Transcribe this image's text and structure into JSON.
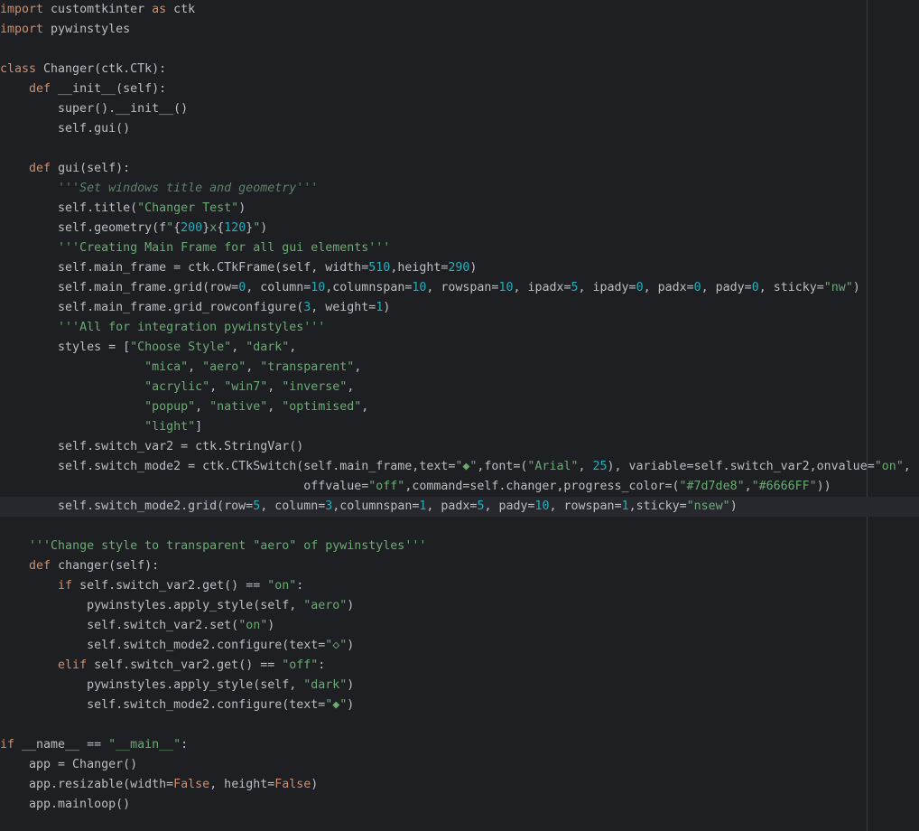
{
  "editor": {
    "colors": {
      "background": "#1e1f22",
      "text": "#bcbec4",
      "keyword": "#cf8e6d",
      "string": "#6aab73",
      "docstring": "#5f826b",
      "number": "#2aacb8",
      "current_line": "#26282e"
    },
    "current_line_index": 25,
    "lines": [
      [
        [
          "kw",
          "import"
        ],
        [
          "plain",
          " customtkinter "
        ],
        [
          "kw",
          "as"
        ],
        [
          "plain",
          " ctk"
        ]
      ],
      [
        [
          "kw",
          "import"
        ],
        [
          "plain",
          " pywinstyles"
        ]
      ],
      [],
      [
        [
          "kw",
          "class"
        ],
        [
          "plain",
          " Changer(ctk.CTk):"
        ]
      ],
      [
        [
          "plain",
          "    "
        ],
        [
          "kw",
          "def"
        ],
        [
          "plain",
          " __init__(self):"
        ]
      ],
      [
        [
          "plain",
          "        super().__init__()"
        ]
      ],
      [
        [
          "plain",
          "        self.gui()"
        ]
      ],
      [],
      [
        [
          "plain",
          "    "
        ],
        [
          "kw",
          "def"
        ],
        [
          "plain",
          " gui(self):"
        ]
      ],
      [
        [
          "plain",
          "        "
        ],
        [
          "doc",
          "'''Set windows title and geometry'''"
        ]
      ],
      [
        [
          "plain",
          "        self.title("
        ],
        [
          "str",
          "\"Changer Test\""
        ],
        [
          "plain",
          ")"
        ]
      ],
      [
        [
          "plain",
          "        self.geometry(f"
        ],
        [
          "str",
          "\""
        ],
        [
          "plain",
          "{"
        ],
        [
          "num",
          "200"
        ],
        [
          "plain",
          "}"
        ],
        [
          "str",
          "x"
        ],
        [
          "plain",
          "{"
        ],
        [
          "num",
          "120"
        ],
        [
          "plain",
          "}"
        ],
        [
          "str",
          "\""
        ],
        [
          "plain",
          ")"
        ]
      ],
      [
        [
          "plain",
          "        "
        ],
        [
          "str",
          "'''Creating Main Frame for all gui elements'''"
        ]
      ],
      [
        [
          "plain",
          "        self.main_frame = ctk.CTkFrame(self, width="
        ],
        [
          "num",
          "510"
        ],
        [
          "plain",
          ",height="
        ],
        [
          "num",
          "290"
        ],
        [
          "plain",
          ")"
        ]
      ],
      [
        [
          "plain",
          "        self.main_frame.grid(row="
        ],
        [
          "num",
          "0"
        ],
        [
          "plain",
          ", column="
        ],
        [
          "num",
          "10"
        ],
        [
          "plain",
          ",columnspan="
        ],
        [
          "num",
          "10"
        ],
        [
          "plain",
          ", rowspan="
        ],
        [
          "num",
          "10"
        ],
        [
          "plain",
          ", ipadx="
        ],
        [
          "num",
          "5"
        ],
        [
          "plain",
          ", ipady="
        ],
        [
          "num",
          "0"
        ],
        [
          "plain",
          ", padx="
        ],
        [
          "num",
          "0"
        ],
        [
          "plain",
          ", pady="
        ],
        [
          "num",
          "0"
        ],
        [
          "plain",
          ", sticky="
        ],
        [
          "str",
          "\"nw\""
        ],
        [
          "plain",
          ")"
        ]
      ],
      [
        [
          "plain",
          "        self.main_frame.grid_rowconfigure("
        ],
        [
          "num",
          "3"
        ],
        [
          "plain",
          ", weight="
        ],
        [
          "num",
          "1"
        ],
        [
          "plain",
          ")"
        ]
      ],
      [
        [
          "plain",
          "        "
        ],
        [
          "str",
          "'''All for integration pywinstyles'''"
        ]
      ],
      [
        [
          "plain",
          "        styles = ["
        ],
        [
          "str",
          "\"Choose Style\""
        ],
        [
          "plain",
          ", "
        ],
        [
          "str",
          "\"dark\""
        ],
        [
          "plain",
          ","
        ]
      ],
      [
        [
          "plain",
          "                    "
        ],
        [
          "str",
          "\"mica\""
        ],
        [
          "plain",
          ", "
        ],
        [
          "str",
          "\"aero\""
        ],
        [
          "plain",
          ", "
        ],
        [
          "str",
          "\"transparent\""
        ],
        [
          "plain",
          ","
        ]
      ],
      [
        [
          "plain",
          "                    "
        ],
        [
          "str",
          "\"acrylic\""
        ],
        [
          "plain",
          ", "
        ],
        [
          "str",
          "\"win7\""
        ],
        [
          "plain",
          ", "
        ],
        [
          "str",
          "\"inverse\""
        ],
        [
          "plain",
          ","
        ]
      ],
      [
        [
          "plain",
          "                    "
        ],
        [
          "str",
          "\"popup\""
        ],
        [
          "plain",
          ", "
        ],
        [
          "str",
          "\"native\""
        ],
        [
          "plain",
          ", "
        ],
        [
          "str",
          "\"optimised\""
        ],
        [
          "plain",
          ","
        ]
      ],
      [
        [
          "plain",
          "                    "
        ],
        [
          "str",
          "\"light\""
        ],
        [
          "plain",
          "]"
        ]
      ],
      [
        [
          "plain",
          "        self.switch_var2 = ctk.StringVar()"
        ]
      ],
      [
        [
          "plain",
          "        self.switch_mode2 = ctk.CTkSwitch(self.main_frame,text="
        ],
        [
          "str",
          "\"◆\""
        ],
        [
          "plain",
          ",font=("
        ],
        [
          "str",
          "\"Arial\""
        ],
        [
          "plain",
          ", "
        ],
        [
          "num",
          "25"
        ],
        [
          "plain",
          "), variable=self.switch_var2,onvalue="
        ],
        [
          "str",
          "\"on\""
        ],
        [
          "plain",
          ","
        ]
      ],
      [
        [
          "plain",
          "                                          offvalue="
        ],
        [
          "str",
          "\"off\""
        ],
        [
          "plain",
          ",command=self.changer,progress_color=("
        ],
        [
          "str",
          "\"#7d7de8\""
        ],
        [
          "plain",
          ","
        ],
        [
          "str",
          "\"#6666FF\""
        ],
        [
          "plain",
          "))"
        ]
      ],
      [
        [
          "plain",
          "        self.switch_mode2.grid(row="
        ],
        [
          "num",
          "5"
        ],
        [
          "plain",
          ", column="
        ],
        [
          "num",
          "3"
        ],
        [
          "plain",
          ",columnspan="
        ],
        [
          "num",
          "1"
        ],
        [
          "plain",
          ", padx="
        ],
        [
          "num",
          "5"
        ],
        [
          "plain",
          ", pady="
        ],
        [
          "num",
          "10"
        ],
        [
          "plain",
          ", rowspan="
        ],
        [
          "num",
          "1"
        ],
        [
          "plain",
          ",sticky="
        ],
        [
          "str",
          "\"nsew\""
        ],
        [
          "plain",
          ")"
        ]
      ],
      [],
      [
        [
          "plain",
          "    "
        ],
        [
          "str",
          "'''Change style to transparent \"aero\" of pywinstyles'''"
        ]
      ],
      [
        [
          "plain",
          "    "
        ],
        [
          "kw",
          "def"
        ],
        [
          "plain",
          " changer(self):"
        ]
      ],
      [
        [
          "plain",
          "        "
        ],
        [
          "kw",
          "if"
        ],
        [
          "plain",
          " self.switch_var2.get() == "
        ],
        [
          "str",
          "\"on\""
        ],
        [
          "plain",
          ":"
        ]
      ],
      [
        [
          "plain",
          "            pywinstyles.apply_style(self, "
        ],
        [
          "str",
          "\"aero\""
        ],
        [
          "plain",
          ")"
        ]
      ],
      [
        [
          "plain",
          "            self.switch_var2.set("
        ],
        [
          "str",
          "\"on\""
        ],
        [
          "plain",
          ")"
        ]
      ],
      [
        [
          "plain",
          "            self.switch_mode2.configure(text="
        ],
        [
          "str",
          "\"◇\""
        ],
        [
          "plain",
          ")"
        ]
      ],
      [
        [
          "plain",
          "        "
        ],
        [
          "kw",
          "elif"
        ],
        [
          "plain",
          " self.switch_var2.get() == "
        ],
        [
          "str",
          "\"off\""
        ],
        [
          "plain",
          ":"
        ]
      ],
      [
        [
          "plain",
          "            pywinstyles.apply_style(self, "
        ],
        [
          "str",
          "\"dark\""
        ],
        [
          "plain",
          ")"
        ]
      ],
      [
        [
          "plain",
          "            self.switch_mode2.configure(text="
        ],
        [
          "str",
          "\"◆\""
        ],
        [
          "plain",
          ")"
        ]
      ],
      [],
      [
        [
          "kw",
          "if"
        ],
        [
          "plain",
          " __name__ == "
        ],
        [
          "str",
          "\"__main__\""
        ],
        [
          "plain",
          ":"
        ]
      ],
      [
        [
          "plain",
          "    app = Changer()"
        ]
      ],
      [
        [
          "plain",
          "    app.resizable(width="
        ],
        [
          "kw",
          "False"
        ],
        [
          "plain",
          ", height="
        ],
        [
          "kw",
          "False"
        ],
        [
          "plain",
          ")"
        ]
      ],
      [
        [
          "plain",
          "    app.mainloop()"
        ]
      ]
    ]
  }
}
